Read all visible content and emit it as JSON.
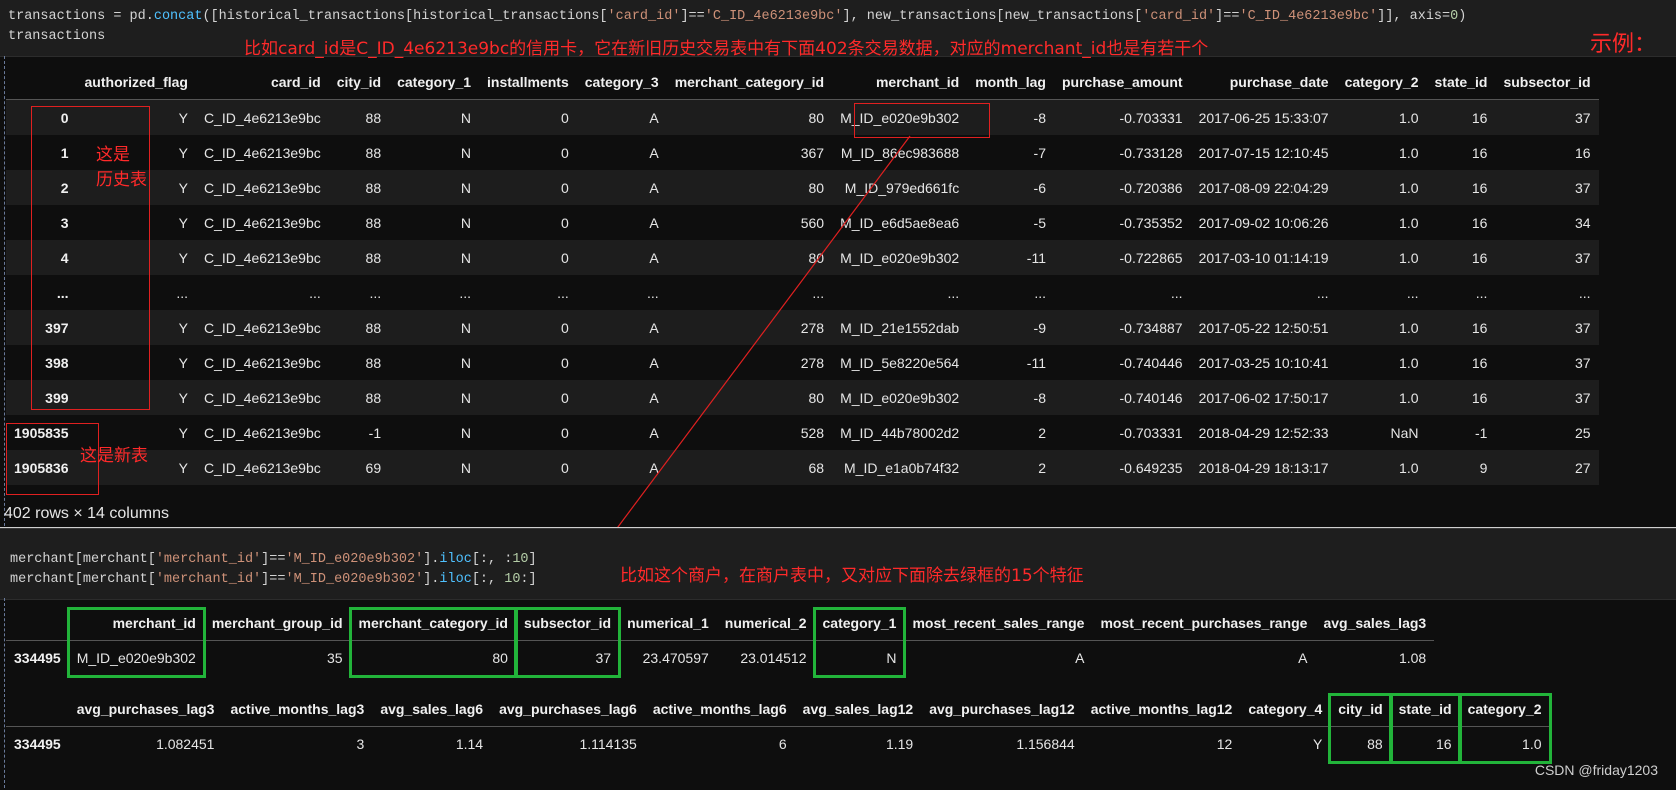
{
  "cell1": {
    "line1": {
      "var": "transactions",
      "op": " = ",
      "mod": "pd",
      "dot": ".",
      "fn": "concat",
      "a1": "([historical_transactions[historical_transactions[",
      "key1": "'card_id'",
      "eq1": "]==",
      "val1": "'C_ID_4e6213e9bc'",
      "a2": "], new_transactions[new_transactions[",
      "key2": "'card_id'",
      "eq2": "]==",
      "val2": "'C_ID_4e6213e9bc'",
      "a3": "]], axis=",
      "num": "0",
      "end": ")"
    },
    "line2": "transactions"
  },
  "annotations": {
    "top_note": "比如card_id是C_ID_4e6213e9bc的信用卡，它在新旧历史交易表中有下面402条交易数据，对应的merchant_id也是有若干个",
    "example": "示例：",
    "hist_note_1": "这是",
    "hist_note_2": "历史表",
    "new_note": "这是新表",
    "merchant_note": "比如这个商户，在商户表中，又对应下面除去绿框的15个特征"
  },
  "transactions_table": {
    "columns": [
      "",
      "authorized_flag",
      "card_id",
      "city_id",
      "category_1",
      "installments",
      "category_3",
      "merchant_category_id",
      "merchant_id",
      "month_lag",
      "purchase_amount",
      "purchase_date",
      "category_2",
      "state_id",
      "subsector_id"
    ],
    "rows": [
      [
        "0",
        "Y",
        "C_ID_4e6213e9bc",
        "88",
        "N",
        "0",
        "A",
        "80",
        "M_ID_e020e9b302",
        "-8",
        "-0.703331",
        "2017-06-25 15:33:07",
        "1.0",
        "16",
        "37"
      ],
      [
        "1",
        "Y",
        "C_ID_4e6213e9bc",
        "88",
        "N",
        "0",
        "A",
        "367",
        "M_ID_86ec983688",
        "-7",
        "-0.733128",
        "2017-07-15 12:10:45",
        "1.0",
        "16",
        "16"
      ],
      [
        "2",
        "Y",
        "C_ID_4e6213e9bc",
        "88",
        "N",
        "0",
        "A",
        "80",
        "M_ID_979ed661fc",
        "-6",
        "-0.720386",
        "2017-08-09 22:04:29",
        "1.0",
        "16",
        "37"
      ],
      [
        "3",
        "Y",
        "C_ID_4e6213e9bc",
        "88",
        "N",
        "0",
        "A",
        "560",
        "M_ID_e6d5ae8ea6",
        "-5",
        "-0.735352",
        "2017-09-02 10:06:26",
        "1.0",
        "16",
        "34"
      ],
      [
        "4",
        "Y",
        "C_ID_4e6213e9bc",
        "88",
        "N",
        "0",
        "A",
        "80",
        "M_ID_e020e9b302",
        "-11",
        "-0.722865",
        "2017-03-10 01:14:19",
        "1.0",
        "16",
        "37"
      ],
      [
        "...",
        "...",
        "...",
        "...",
        "...",
        "...",
        "...",
        "...",
        "...",
        "...",
        "...",
        "...",
        "...",
        "...",
        "..."
      ],
      [
        "397",
        "Y",
        "C_ID_4e6213e9bc",
        "88",
        "N",
        "0",
        "A",
        "278",
        "M_ID_21e1552dab",
        "-9",
        "-0.734887",
        "2017-05-22 12:50:51",
        "1.0",
        "16",
        "37"
      ],
      [
        "398",
        "Y",
        "C_ID_4e6213e9bc",
        "88",
        "N",
        "0",
        "A",
        "278",
        "M_ID_5e8220e564",
        "-11",
        "-0.740446",
        "2017-03-25 10:10:41",
        "1.0",
        "16",
        "37"
      ],
      [
        "399",
        "Y",
        "C_ID_4e6213e9bc",
        "88",
        "N",
        "0",
        "A",
        "80",
        "M_ID_e020e9b302",
        "-8",
        "-0.740146",
        "2017-06-02 17:50:17",
        "1.0",
        "16",
        "37"
      ],
      [
        "1905835",
        "Y",
        "C_ID_4e6213e9bc",
        "-1",
        "N",
        "0",
        "A",
        "528",
        "M_ID_44b78002d2",
        "2",
        "-0.703331",
        "2018-04-29 12:52:33",
        "NaN",
        "-1",
        "25"
      ],
      [
        "1905836",
        "Y",
        "C_ID_4e6213e9bc",
        "69",
        "N",
        "0",
        "A",
        "68",
        "M_ID_e1a0b74f32",
        "2",
        "-0.649235",
        "2018-04-29 18:13:17",
        "1.0",
        "9",
        "27"
      ]
    ],
    "shape": "402 rows × 14 columns"
  },
  "cell2": {
    "l1": {
      "a": "merchant[merchant[",
      "key": "'merchant_id'",
      "b": "]==",
      "val": "'M_ID_e020e9b302'",
      "c": "].",
      "fn": "iloc",
      "d": "[:, :",
      "num": "10",
      "e": "]"
    },
    "l2": {
      "a": "merchant[merchant[",
      "key": "'merchant_id'",
      "b": "]==",
      "val": "'M_ID_e020e9b302'",
      "c": "].",
      "fn": "iloc",
      "d": "[:, ",
      "num": "10",
      "e": ":]"
    }
  },
  "merchant_table_1": {
    "columns": [
      "",
      "merchant_id",
      "merchant_group_id",
      "merchant_category_id",
      "subsector_id",
      "numerical_1",
      "numerical_2",
      "category_1",
      "most_recent_sales_range",
      "most_recent_purchases_range",
      "avg_sales_lag3"
    ],
    "row": [
      "334495",
      "M_ID_e020e9b302",
      "35",
      "80",
      "37",
      "23.470597",
      "23.014512",
      "N",
      "A",
      "A",
      "1.08"
    ]
  },
  "merchant_table_2": {
    "columns": [
      "",
      "avg_purchases_lag3",
      "active_months_lag3",
      "avg_sales_lag6",
      "avg_purchases_lag6",
      "active_months_lag6",
      "avg_sales_lag12",
      "avg_purchases_lag12",
      "active_months_lag12",
      "category_4",
      "city_id",
      "state_id",
      "category_2"
    ],
    "row": [
      "334495",
      "1.082451",
      "3",
      "1.14",
      "1.114135",
      "6",
      "1.19",
      "1.156844",
      "12",
      "Y",
      "88",
      "16",
      "1.0"
    ]
  },
  "footer": {
    "watermark": "CSDN @friday1203"
  },
  "colors": {
    "annotation_red": "#ff2a2a",
    "highlight_green": "#22b43a",
    "background": "#0e0e0e"
  }
}
